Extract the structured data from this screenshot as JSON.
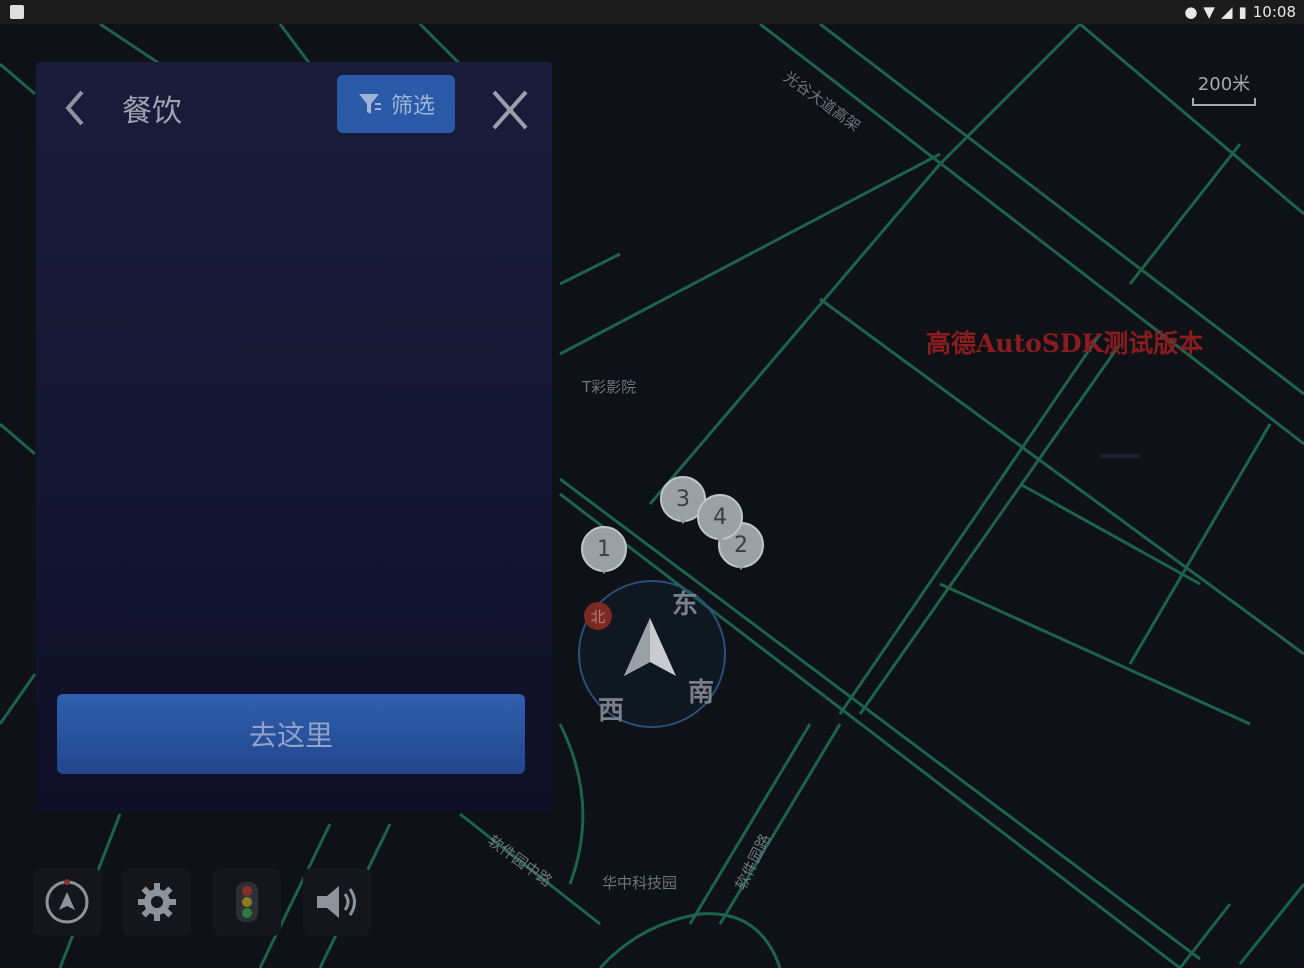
{
  "status_bar": {
    "time": "10:08"
  },
  "map": {
    "scale": {
      "distance": "200米"
    },
    "watermark": "高德AutoSDK测试版本",
    "labels": {
      "guanggu_elevated": "光谷大道高架",
      "software_park_road": "软件园中路",
      "software_park_road2": "软件园路",
      "label_mid": "T彩影院",
      "label_bottom": "华中科技园"
    },
    "compass": {
      "north_badge": "北",
      "east": "东",
      "south": "南",
      "west": "西"
    },
    "poi_markers": [
      "1",
      "2",
      "3",
      "4"
    ]
  },
  "panel": {
    "title": "餐饮",
    "filter_label": "筛选",
    "go_label": "去这里"
  },
  "toolbar": {
    "items": [
      "compass-mode",
      "settings",
      "traffic",
      "volume"
    ]
  },
  "colors": {
    "accent_blue": "#2a5aa8",
    "road": "#1f6b52",
    "watermark": "#8a1b1e"
  }
}
